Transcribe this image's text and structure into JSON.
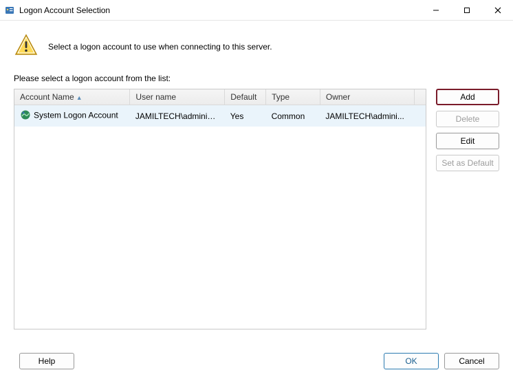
{
  "window": {
    "title": "Logon Account Selection"
  },
  "info": {
    "message": "Select a logon account to use when connecting to this server."
  },
  "list": {
    "label": "Please select a logon account from the list:",
    "columns": {
      "account_name": "Account Name",
      "user_name": "User name",
      "default": "Default",
      "type": "Type",
      "owner": "Owner"
    },
    "rows": [
      {
        "account_name": "System Logon Account",
        "user_name": "JAMILTECH\\administ...",
        "default": "Yes",
        "type": "Common",
        "owner": "JAMILTECH\\admini..."
      }
    ]
  },
  "side_buttons": {
    "add": "Add",
    "delete": "Delete",
    "edit": "Edit",
    "set_default": "Set as Default"
  },
  "footer": {
    "help": "Help",
    "ok": "OK",
    "cancel": "Cancel"
  }
}
